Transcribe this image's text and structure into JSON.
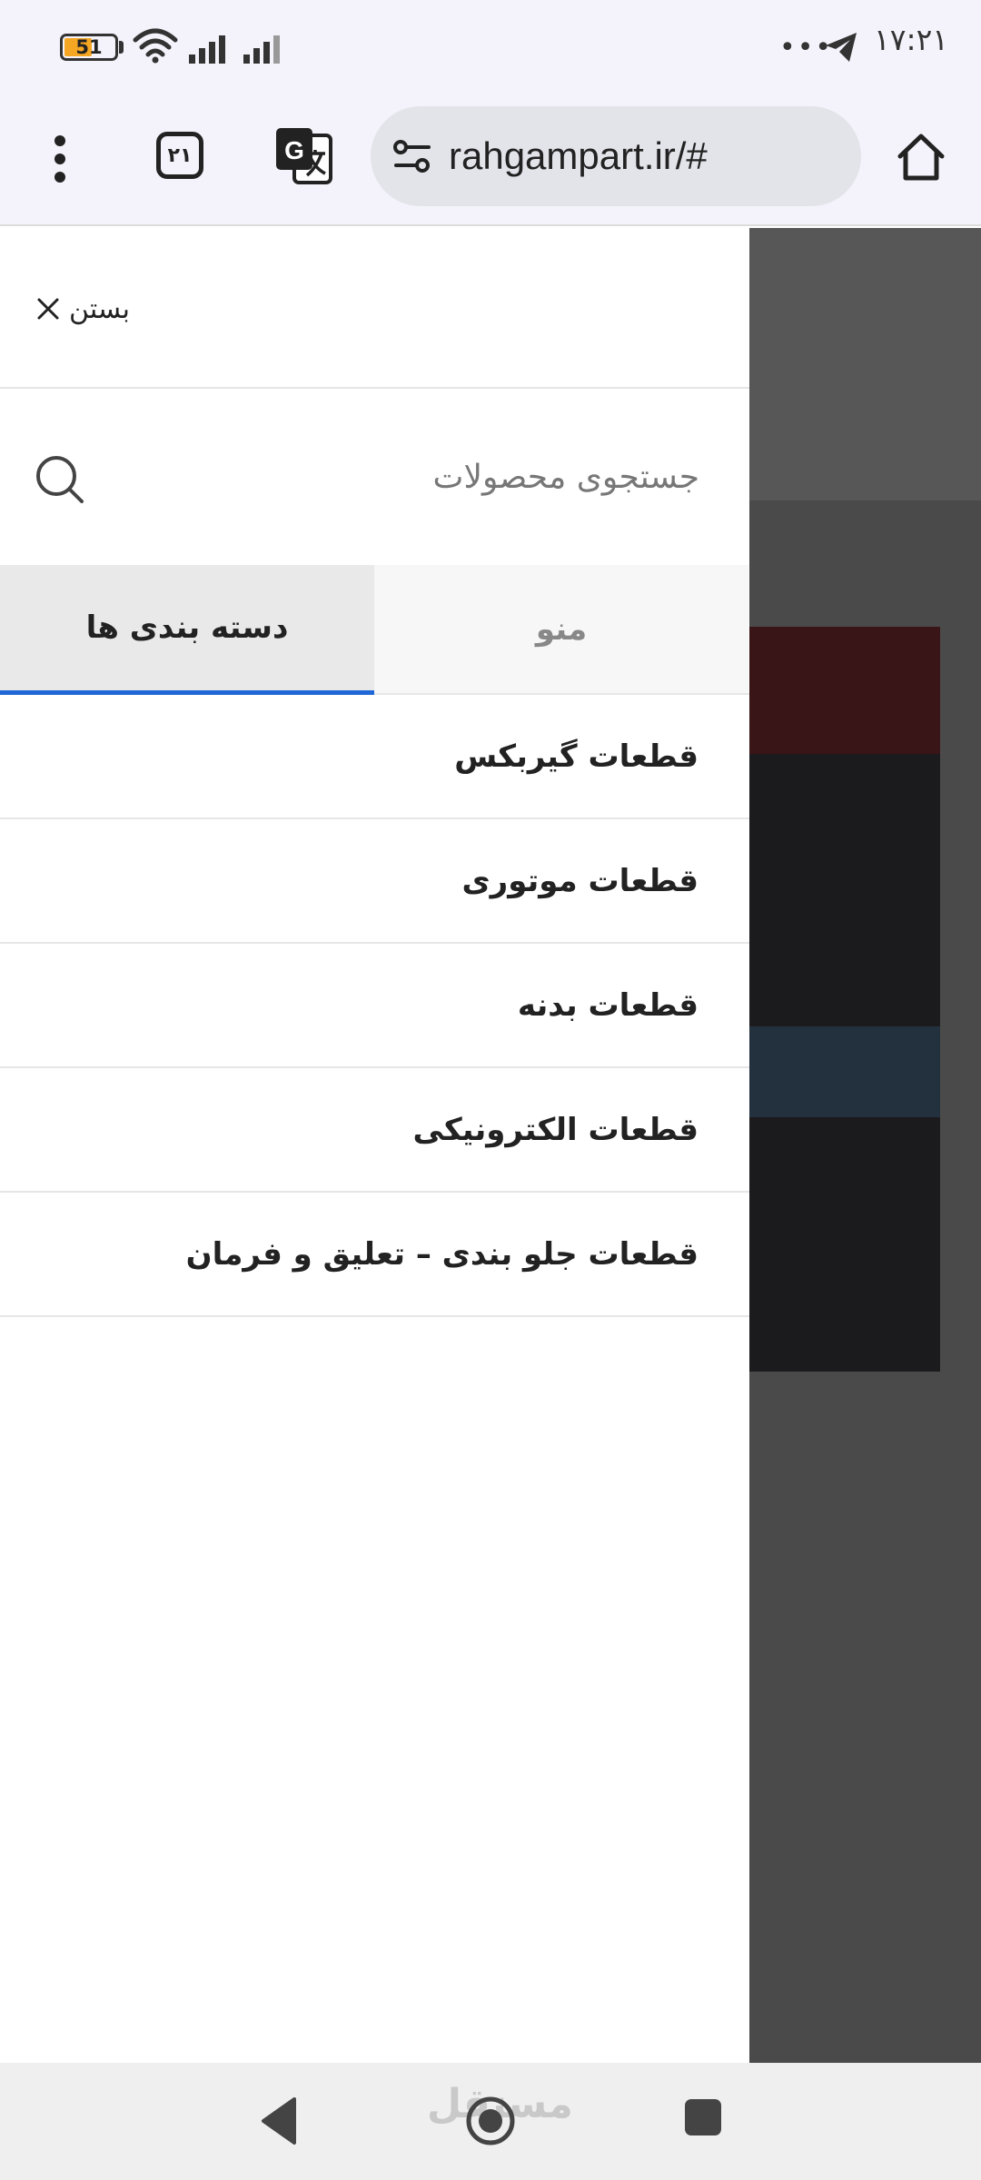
{
  "status_bar": {
    "battery_level": "51",
    "time": "۱۷:۲۱",
    "overflow_dots": "•••"
  },
  "browser": {
    "tab_count": "۲۱",
    "url": "rahgampart.ir/#",
    "accent_color": "#1f66d6"
  },
  "drawer": {
    "close_label": "بستن",
    "search": {
      "placeholder": "جستجوی محصولات",
      "value": ""
    },
    "tabs": [
      {
        "label": "دسته بندی ها",
        "active": true
      },
      {
        "label": "منو",
        "active": false
      }
    ],
    "categories": [
      {
        "label": "قطعات گیربکس"
      },
      {
        "label": "قطعات موتوری"
      },
      {
        "label": "قطعات بدنه"
      },
      {
        "label": "قطعات الکترونیکی"
      },
      {
        "label": "قطعات جلو بندی – تعلیق و فرمان"
      }
    ]
  },
  "nav_bar": {
    "watermark": "مستقل"
  }
}
